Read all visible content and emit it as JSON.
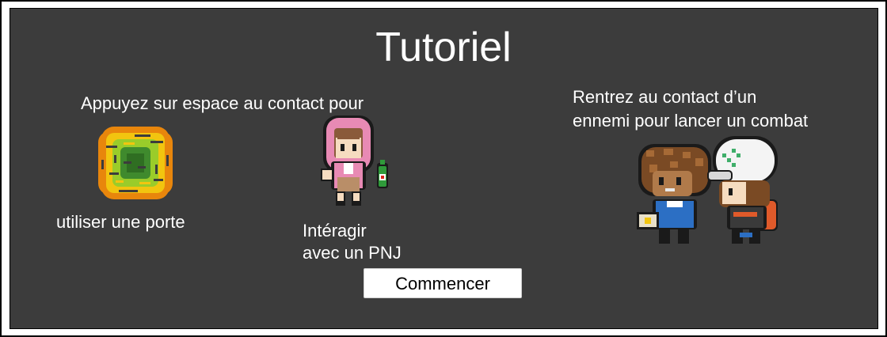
{
  "title": "Tutoriel",
  "left_heading": "Appuyez sur espace au contact pour",
  "door_caption": "utiliser une porte",
  "npc_caption_line1": "Intéragir",
  "npc_caption_line2": "avec un PNJ",
  "right_heading_line1": "Rentrez au contact d’un",
  "right_heading_line2": "ennemi pour lancer un combat",
  "start_button": "Commencer",
  "icons": [
    "door-portal-icon",
    "npc-character-icon",
    "enemy-trainer-icon",
    "player-character-icon"
  ],
  "colors": {
    "panel": "#3c3c3c",
    "text": "#ffffff",
    "button": "#ffffff"
  }
}
